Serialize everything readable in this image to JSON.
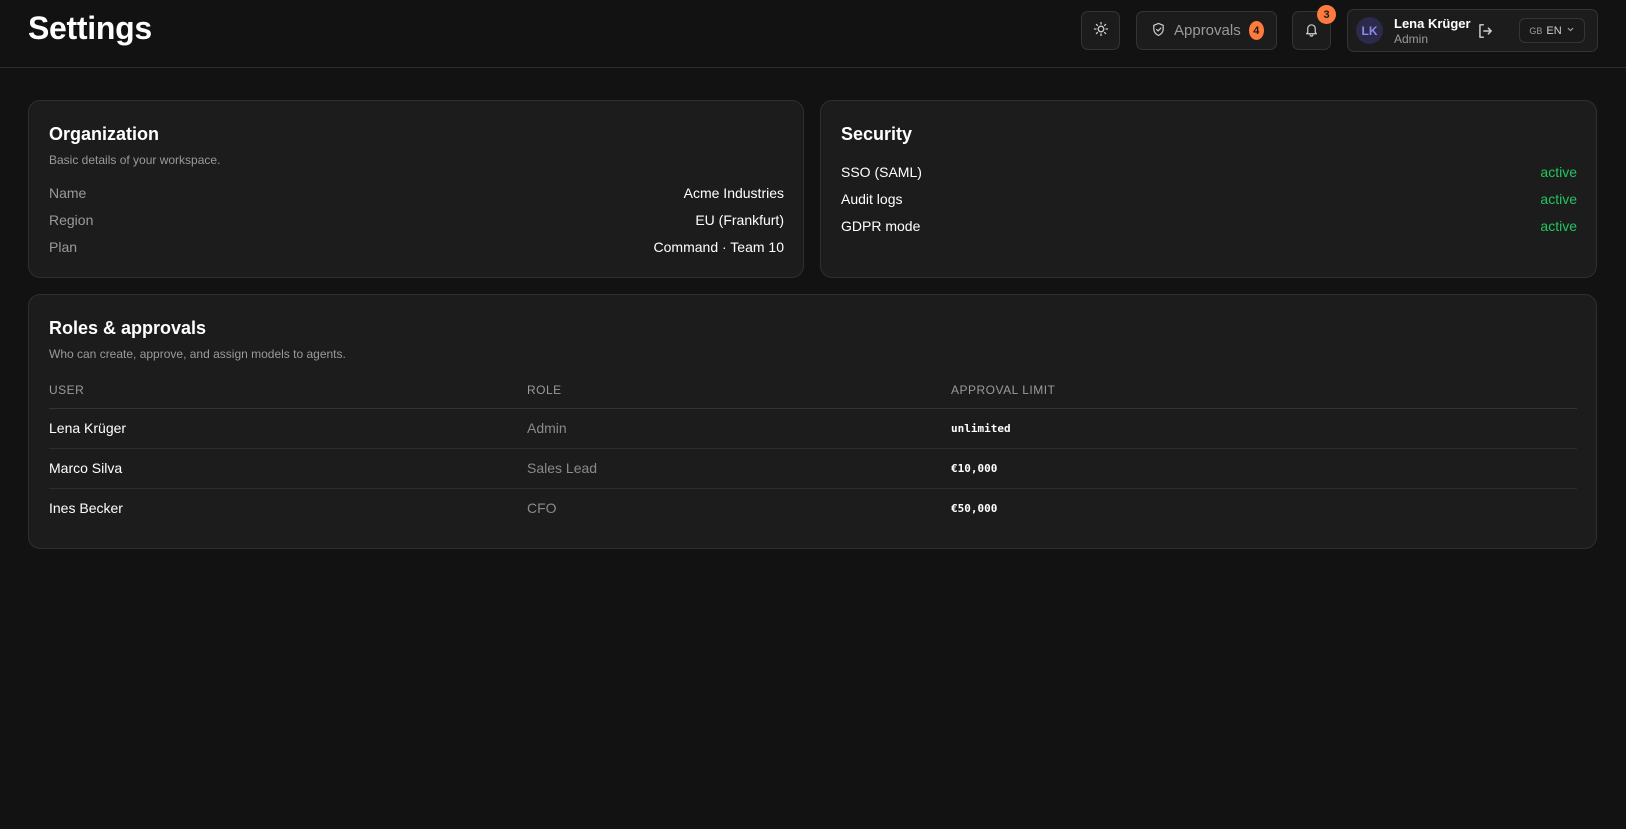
{
  "page": {
    "title": "Settings"
  },
  "header": {
    "approvals": {
      "label": "Approvals",
      "count": "4"
    },
    "notifications": {
      "count": "3"
    },
    "user": {
      "initials": "LK",
      "name": "Lena Krüger",
      "role": "Admin"
    },
    "language": {
      "flag": "GB",
      "code": "EN"
    }
  },
  "organization": {
    "title": "Organization",
    "subtitle": "Basic details of your workspace.",
    "fields": [
      {
        "label": "Name",
        "value": "Acme Industries"
      },
      {
        "label": "Region",
        "value": "EU (Frankfurt)"
      },
      {
        "label": "Plan",
        "value": "Command · Team 10"
      }
    ]
  },
  "security": {
    "title": "Security",
    "items": [
      {
        "label": "SSO (SAML)",
        "status": "active"
      },
      {
        "label": "Audit logs",
        "status": "active"
      },
      {
        "label": "GDPR mode",
        "status": "active"
      }
    ],
    "status_color": "#22c55e"
  },
  "roles": {
    "title": "Roles & approvals",
    "subtitle": "Who can create, approve, and assign models to agents.",
    "columns": [
      "USER",
      "ROLE",
      "APPROVAL LIMIT"
    ],
    "rows": [
      {
        "user": "Lena Krüger",
        "role": "Admin",
        "limit": "unlimited"
      },
      {
        "user": "Marco Silva",
        "role": "Sales Lead",
        "limit": "€10,000"
      },
      {
        "user": "Ines Becker",
        "role": "CFO",
        "limit": "€50,000"
      }
    ]
  },
  "colors": {
    "accent": "#ff7a3d",
    "background": "#121212",
    "card": "#1c1c1c"
  },
  "icons": [
    "sun-icon",
    "shield-icon",
    "bell-icon",
    "logout-icon",
    "chevron-down-icon"
  ]
}
